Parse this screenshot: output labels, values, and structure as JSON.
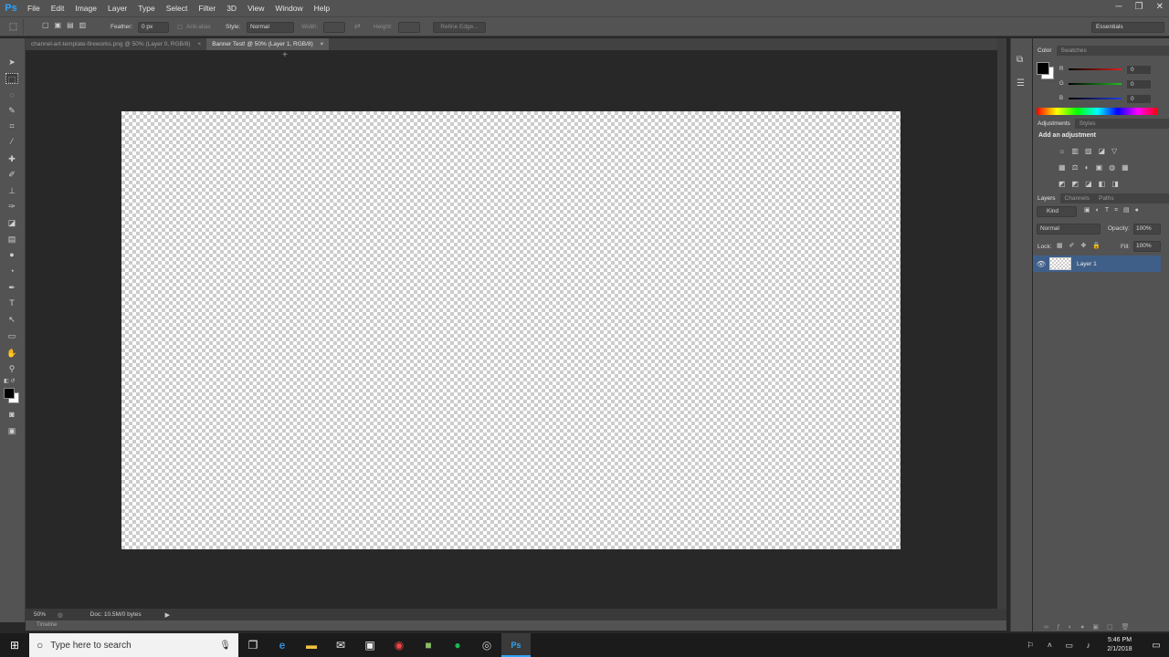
{
  "app": {
    "logo": "Ps"
  },
  "menu": [
    "File",
    "Edit",
    "Image",
    "Layer",
    "Type",
    "Select",
    "Filter",
    "3D",
    "View",
    "Window",
    "Help"
  ],
  "window_controls": {
    "minimize": "─",
    "restore": "❐",
    "close": "✕"
  },
  "options": {
    "feather_label": "Feather:",
    "feather_value": "0 px",
    "antialias_label": "Anti-alias",
    "style_label": "Style:",
    "style_value": "Normal",
    "width_label": "Width:",
    "height_label": "Height:",
    "refine_edge": "Refine Edge...",
    "workspace": "Essentials"
  },
  "tabs": [
    {
      "label": "channel-art-template-fireworks.png @ 50% (Layer 0, RGB/8)",
      "close": "×"
    },
    {
      "label": "Banner Test! @ 50% (Layer 1, RGB/8)",
      "close": "×"
    }
  ],
  "status": {
    "zoom": "50%",
    "doc": "Doc: 10.5M/0 bytes",
    "timeline": "Timeline"
  },
  "color_panel": {
    "tabs": [
      "Color",
      "Swatches"
    ],
    "channels": [
      {
        "name": "R",
        "value": "0",
        "color": "#e01e1e"
      },
      {
        "name": "G",
        "value": "0",
        "color": "#1fbf1f"
      },
      {
        "name": "B",
        "value": "0",
        "color": "#1f3ee0"
      }
    ]
  },
  "adjustments_panel": {
    "tabs": [
      "Adjustments",
      "Styles"
    ],
    "heading": "Add an adjustment"
  },
  "layers_panel": {
    "tabs": [
      "Layers",
      "Channels",
      "Paths"
    ],
    "kind": "Kind",
    "blend_mode": "Normal",
    "opacity_label": "Opacity:",
    "opacity_value": "100%",
    "lock_label": "Lock:",
    "fill_label": "Fill:",
    "fill_value": "100%",
    "layers": [
      {
        "name": "Layer 1"
      }
    ]
  },
  "taskbar": {
    "search_placeholder": "Type here to search",
    "time": "5:46 PM",
    "date": "2/1/2018"
  },
  "colors": {
    "accent": "#2fa3f8",
    "selected_layer": "#3f5f89"
  }
}
